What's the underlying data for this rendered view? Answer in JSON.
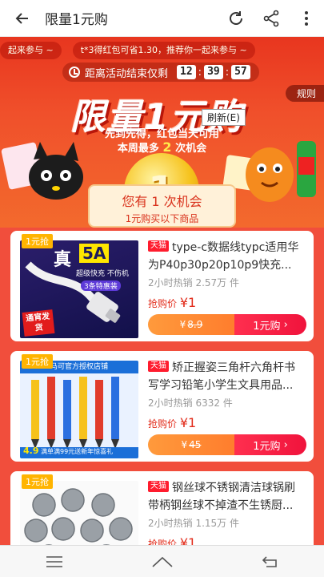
{
  "header": {
    "title": "限量1元购",
    "back_icon": "back-arrow-icon",
    "refresh_icon": "refresh-icon",
    "share_icon": "share-icon",
    "more_icon": "more-vertical-icon"
  },
  "banner": {
    "ticker": [
      "起来参与 ~",
      "t*3得红包可省1.30，推荐你一起来参与 ~"
    ],
    "countdown_label": "距离活动结束仅剩",
    "countdown": {
      "h": "12",
      "m": "39",
      "s": "57"
    },
    "rules": "规则",
    "headline": "限量1元购",
    "refresh_btn": "刷新(E)",
    "tagline": "先到先得，红包当天可用",
    "limit_prefix": "本周最多",
    "limit_count": "2",
    "limit_suffix": "次机会",
    "coin_text": "1",
    "chance_line1": "您有 1 次机会",
    "chance_line2": "1元购买以下商品"
  },
  "products": [
    {
      "badge": "1元抢",
      "store": "天猫",
      "title": "type-c数据线typc适用华为P40p30p20p10p9快充...",
      "sold": "2小时热销 2.57万 件",
      "price_label": "抢购价",
      "price": "¥1",
      "orig_price": "8.9",
      "buy_label": "1元购",
      "image_texts": [
        "真",
        "5A",
        "超级快充 不伤机",
        "3条特惠装",
        "通宵发货"
      ]
    },
    {
      "badge": "1元抢",
      "store": "天猫",
      "title": "矫正握姿三角杆六角杆书写学习铅笔小学生文具用品...",
      "sold": "2小时热销 6332 件",
      "price_label": "抢购价",
      "price": "¥1",
      "orig_price": "45",
      "buy_label": "1元购",
      "image_texts": [
        "马可官方授权店铺",
        "4.9",
        "满单满99元送新年惊喜礼"
      ]
    },
    {
      "badge": "1元抢",
      "store": "天猫",
      "title": "钢丝球不锈钢清洁球锅刷带柄钢丝球不掉渣不生锈厨...",
      "sold": "2小时热销 1.15万 件",
      "price_label": "抢购价",
      "price": "¥1"
    }
  ],
  "navbar": {
    "menu_icon": "menu-icon",
    "home_icon": "home-icon",
    "back_icon": "nav-back-icon"
  },
  "colors": {
    "accent": "#e8361f",
    "price": "#e22b1a",
    "buy": "#f0133c"
  }
}
